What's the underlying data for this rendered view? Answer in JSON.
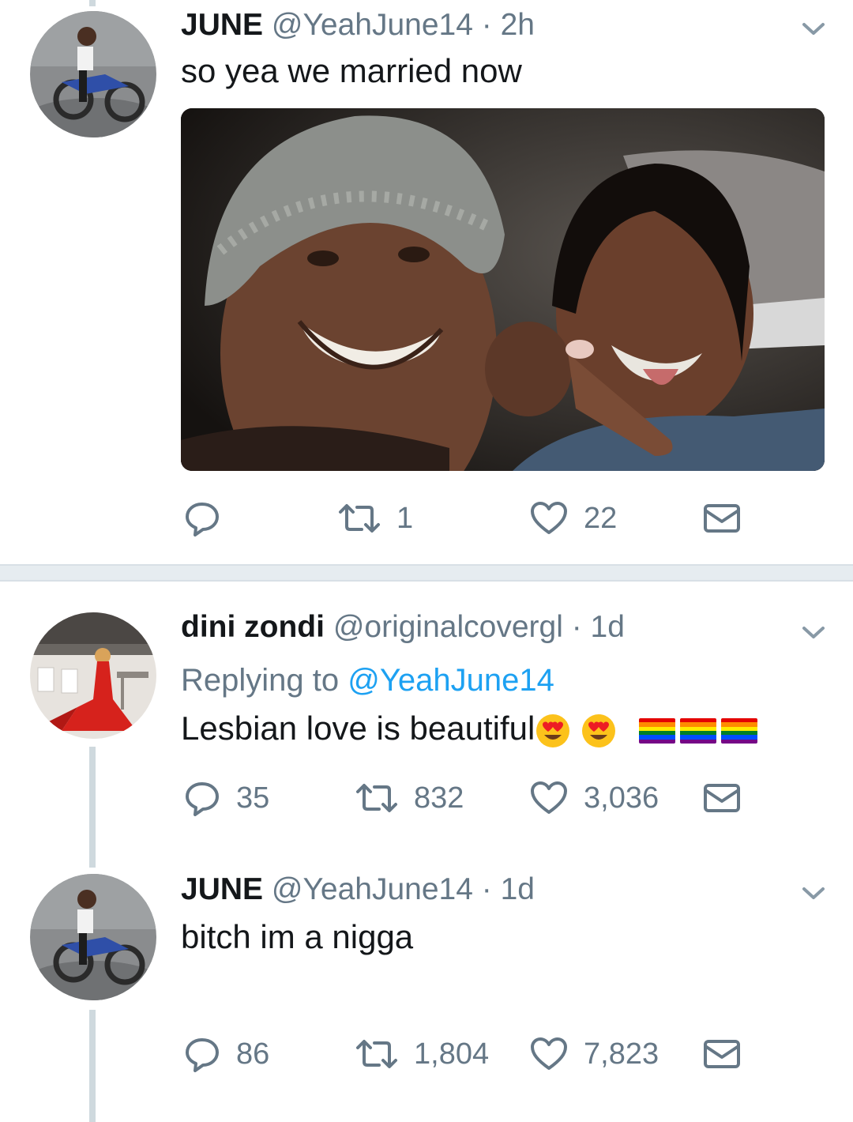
{
  "tweets": [
    {
      "name": "JUNE",
      "handle": "@YeahJune14",
      "time": "· 2h",
      "text": "so yea we married now",
      "reply_count": "",
      "retweet_count": "1",
      "like_count": "22"
    },
    {
      "name": "dini zondi",
      "handle": "@originalcovergl",
      "time": "· 1d",
      "replying_prefix": "Replying to",
      "replying_to": "@YeahJune14",
      "text": "Lesbian love is beautiful",
      "reply_count": "35",
      "retweet_count": "832",
      "like_count": "3,036"
    },
    {
      "name": "JUNE",
      "handle": "@YeahJune14",
      "time": "· 1d",
      "text": "bitch im a nigga",
      "reply_count": "86",
      "retweet_count": "1,804",
      "like_count": "7,823"
    }
  ],
  "icons": {
    "reply": "reply-icon",
    "retweet": "retweet-icon",
    "like": "heart-icon",
    "dm": "envelope-icon",
    "caret": "chevron-down-icon",
    "emoji": "heart-eyes-emoji",
    "flag": "rainbow-flag-emoji"
  },
  "colors": {
    "text": "#14171a",
    "secondary": "#657786",
    "link": "#1da1f2",
    "divider": "#e6ecf0"
  }
}
